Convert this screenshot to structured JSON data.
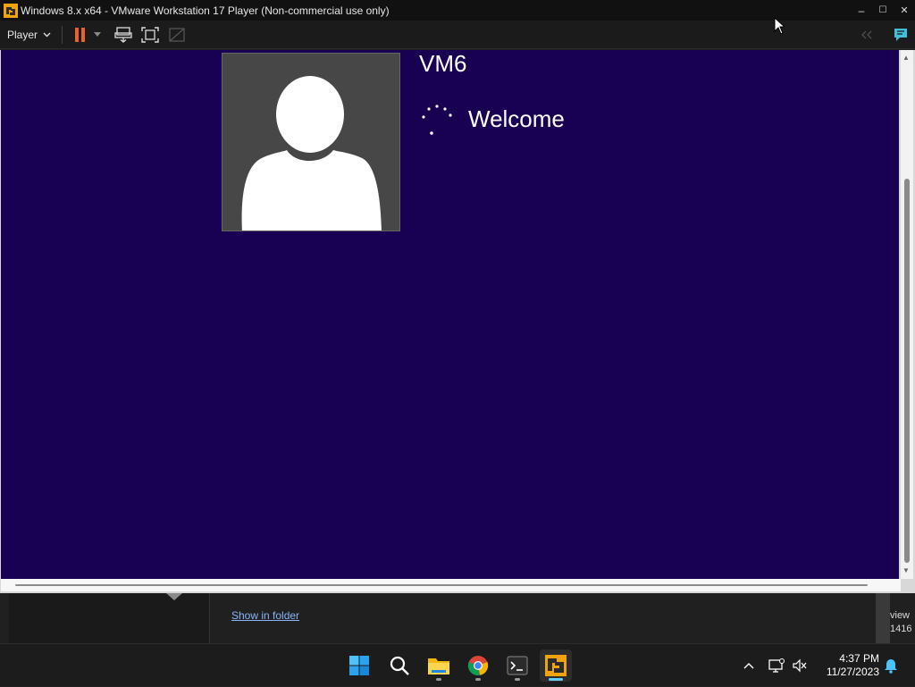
{
  "window": {
    "title": "Windows 8.x x64 - VMware Workstation 17 Player (Non-commercial use only)",
    "minimize_glyph": "–",
    "maximize_glyph": "☐",
    "close_glyph": "✕"
  },
  "toolbar": {
    "player_label": "Player"
  },
  "vm": {
    "user_name": "VM6",
    "status_text": "Welcome"
  },
  "background_app": {
    "link_text": "Show in folder",
    "edge_text_line1": "view",
    "edge_text_line2": "1416"
  },
  "taskbar": {
    "apps": [
      "start-icon",
      "search-icon",
      "file-explorer-icon",
      "chrome-icon",
      "terminal-icon",
      "vmware-player-icon"
    ],
    "time": "4:37 PM",
    "date": "11/27/2023"
  },
  "colors": {
    "vm_background": "#180052",
    "accent": "#60cdff",
    "pause_button": "#e8632b"
  }
}
